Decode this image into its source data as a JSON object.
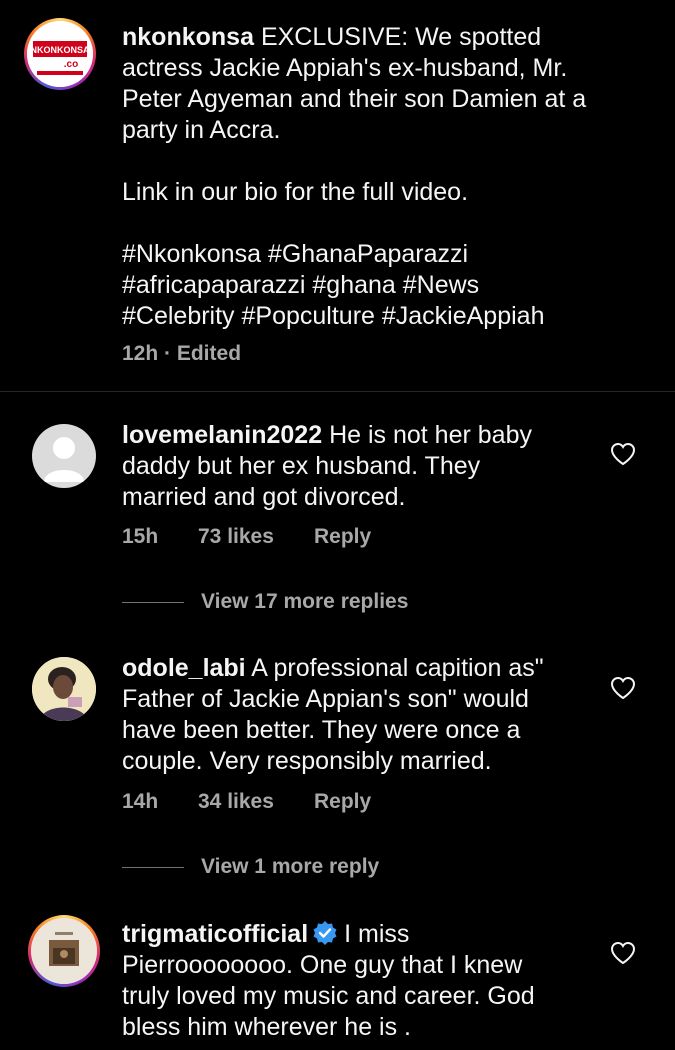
{
  "caption": {
    "username": "nkonkonsa",
    "avatar_logo_text": "NKONKONSA",
    "avatar_logo_sub": ".co",
    "lines": [
      "EXCLUSIVE: We spotted",
      "actress Jackie Appiah's ex-husband, Mr.",
      "Peter Agyeman and their son Damien at a",
      "party in Accra."
    ],
    "link_line": "Link in our bio for the full video.",
    "hashtag_lines": [
      "#Nkonkonsa #GhanaPaparazzi",
      "#africapaparazzi #ghana #News",
      "#Celebrity #Popculture #JackieAppiah"
    ],
    "meta": "12h · Edited"
  },
  "comments": [
    {
      "username": "lovemelanin2022",
      "first_line": "He is not her baby",
      "lines": [
        "daddy but her ex husband. They",
        "married and got divorced."
      ],
      "time": "15h",
      "likes": "73 likes",
      "reply": "Reply",
      "view_more": "View 17 more replies"
    },
    {
      "username": "odole_labi",
      "first_line": "A professional capition as\"",
      "lines": [
        "Father of Jackie Appian's son\" would",
        "have been better. They were once a",
        "couple. Very responsibly married."
      ],
      "time": "14h",
      "likes": "34 likes",
      "reply": "Reply",
      "view_more": "View 1 more reply"
    },
    {
      "username": "trigmaticofficial",
      "first_line": "I miss",
      "lines": [
        "Pierroooooooo. One guy that I knew",
        "truly loved my music and career. God",
        "bless him wherever he is ."
      ]
    }
  ],
  "colors": {
    "background": "#000000",
    "text": "#f5f5f5",
    "secondary": "#a8a8a8",
    "verified": "#3897f0",
    "logo_red": "#d0021b"
  }
}
